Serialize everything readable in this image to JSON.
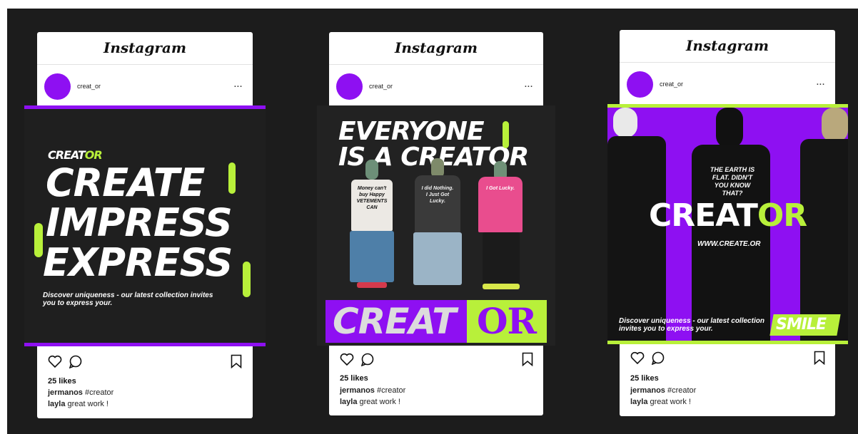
{
  "cards": [
    {
      "brand": "Instagram",
      "username": "creat_or",
      "more": "...",
      "likes": "25 likes",
      "caption_user": "jermanos",
      "caption_text": " #creator",
      "comment_user": "layla",
      "comment_text": " great work !",
      "post": {
        "logo_a": "CREAT",
        "logo_b": "OR",
        "line1": "CREATE",
        "line2": "IMPRESS",
        "line3": "EXPRESS",
        "tagline": "Discover uniqueness - our latest collection invites you to express your."
      }
    },
    {
      "brand": "Instagram",
      "username": "creat_or",
      "more": "...",
      "likes": "25 likes",
      "caption_user": "jermanos",
      "caption_text": " #creator",
      "comment_user": "layla",
      "comment_text": " great work !",
      "post": {
        "line1": "EVERYONE",
        "line2": "IS A CREATOR",
        "tee1": "Money can't buy Happy VETEMENTS CAN",
        "tee2": "I did Nothing. I Just Got Lucky.",
        "tee3": "I Got Lucky.",
        "banner_a": "CREAT",
        "banner_b": "OR"
      }
    },
    {
      "brand": "Instagram",
      "username": "creat_or",
      "more": "...",
      "likes": "25 likes",
      "caption_user": "jermanos",
      "caption_text": " #creator",
      "comment_user": "layla",
      "comment_text": " great work !",
      "post": {
        "shirt_text": "THE EARTH IS FLAT. DIDN'T YOU KNOW THAT?",
        "logo_a": "CREAT",
        "logo_b": "OR",
        "url": "WWW.CREATE.OR",
        "tagline": "Discover uniqueness - our latest collection invites you to express your.",
        "badge": "SMILE"
      }
    }
  ],
  "colors": {
    "purple": "#8e10f2",
    "lime": "#b8f03a",
    "dark": "#1c1c1c"
  }
}
